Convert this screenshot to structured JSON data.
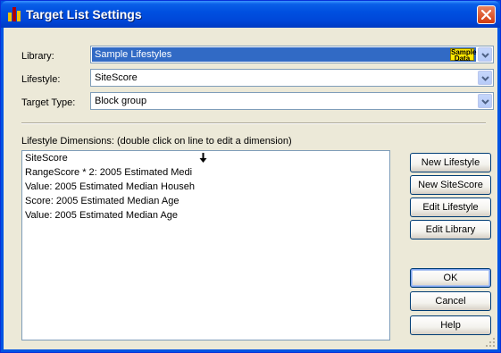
{
  "window": {
    "title": "Target List Settings",
    "colors": {
      "titlebar": "#0054e3",
      "client": "#ece9d8",
      "selection": "#316ac5",
      "badge": "#ffe900"
    }
  },
  "icons": {
    "app": "bar-chart-icon",
    "close": "close-icon",
    "dropdown": "chevron-down-icon",
    "cursor": "down-arrow-cursor-icon"
  },
  "form": {
    "library": {
      "label": "Library:",
      "value": "Sample Lifestyles",
      "badge_line1": "Sample",
      "badge_line2": "Data"
    },
    "lifestyle": {
      "label": "Lifestyle:",
      "value": "SiteScore"
    },
    "target_type": {
      "label": "Target Type:",
      "value": "Block group"
    }
  },
  "dimensions": {
    "label": "Lifestyle Dimensions: (double click on line to edit a dimension)",
    "items": [
      "SiteScore",
      "RangeScore * 2: 2005 Estimated Medi",
      "Value: 2005 Estimated Median Househ",
      "Score: 2005 Estimated Median Age",
      "Value: 2005 Estimated Median Age"
    ]
  },
  "buttons": {
    "new_lifestyle": "New Lifestyle",
    "new_sitescore": "New SiteScore",
    "edit_lifestyle": "Edit Lifestyle",
    "edit_library": "Edit Library",
    "ok": "OK",
    "cancel": "Cancel",
    "help": "Help"
  }
}
